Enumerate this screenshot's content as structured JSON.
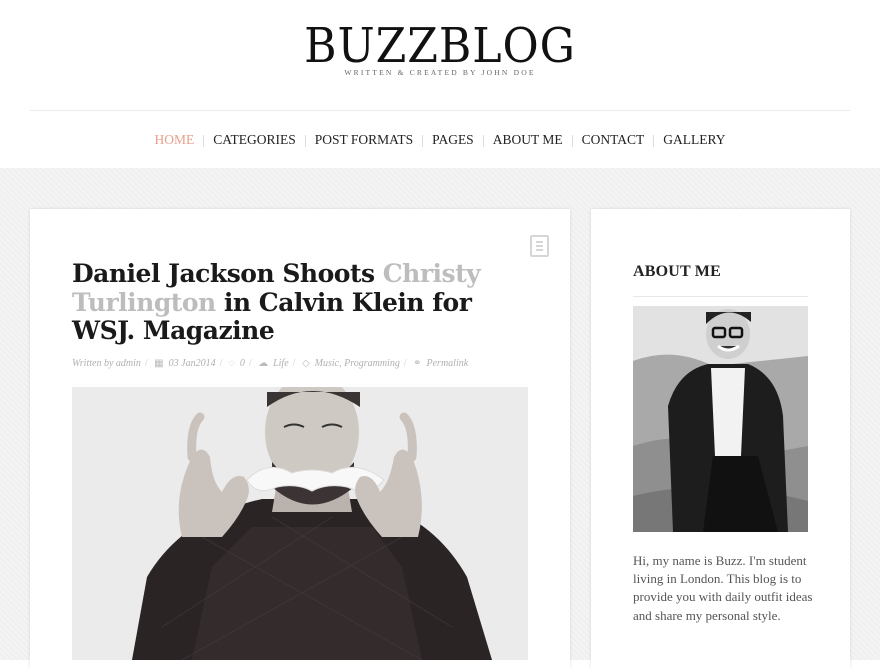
{
  "site": {
    "logo": "BUZZBLOG",
    "tagline": "WRITTEN & CREATED BY JOHN DOE"
  },
  "nav": {
    "items": [
      {
        "label": "HOME",
        "active": true
      },
      {
        "label": "CATEGORIES",
        "active": false
      },
      {
        "label": "POST FORMATS",
        "active": false
      },
      {
        "label": "PAGES",
        "active": false
      },
      {
        "label": "ABOUT ME",
        "active": false
      },
      {
        "label": "CONTACT",
        "active": false
      },
      {
        "label": "GALLERY",
        "active": false
      }
    ]
  },
  "post": {
    "title_part1": "Daniel Jackson Shoots ",
    "title_link": "Christy Turlington",
    "title_part2": " in Calvin Klein for WSJ. Magazine",
    "format_icon": "document-icon",
    "meta": {
      "author": "Written by admin",
      "date": "03 Jan2014",
      "comments": "0",
      "category": "Life",
      "tags": "Music, Programming",
      "permalink": "Permalink"
    },
    "image_alt": "Man in dark sweater holding a paper mustache in front of his face"
  },
  "sidebar": {
    "widget_title": "ABOUT ME",
    "photo_alt": "Smiling man with glasses in leather jacket",
    "bio": "Hi, my name is Buzz. I'm student living in London. This blog is to provide you with daily outfit ideas and share my personal style."
  },
  "colors": {
    "accent": "#e8a08a",
    "muted_title": "#bdbdbd",
    "background": "#f3f3f3"
  }
}
